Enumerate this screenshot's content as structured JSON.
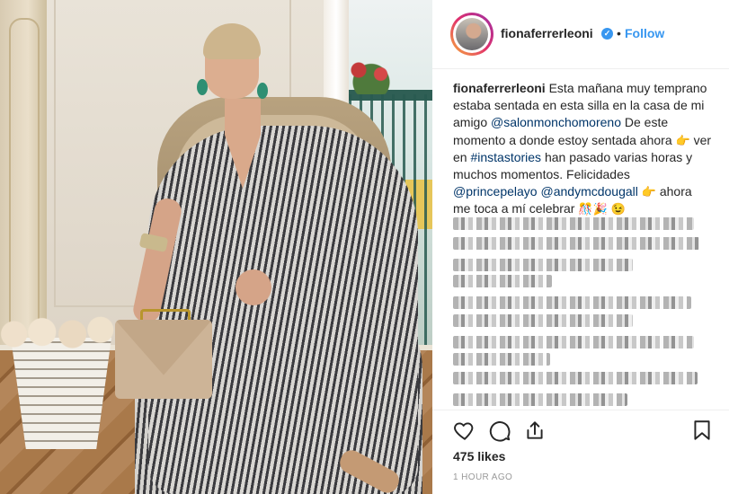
{
  "post": {
    "username": "fionaferrerleoni",
    "verified_mark": "✓",
    "separator": "•",
    "follow_label": "Follow",
    "caption": {
      "username": "fionaferrerleoni",
      "text_1": " Esta mañana muy temprano estaba sentada en esta silla en la casa de mi amigo ",
      "mention_1": "@salonmonchomoreno",
      "text_2": " De este momento a donde estoy sentada ahora ",
      "emoji_1": "👉",
      "text_3": " ver en ",
      "hashtag_1": "#instastories",
      "text_4": " han pasado varias horas y muchos momentos. Felicidades ",
      "mention_2": "@princepelayo",
      "text_5": " ",
      "mention_3": "@andymcdougall",
      "text_6": " ",
      "emoji_2": "👉",
      "text_7": " ahora me toca a mí celebrar ",
      "emoji_3": "🎊",
      "emoji_4": "🎉",
      "emoji_5": "😉"
    },
    "likes": "475 likes",
    "timestamp": "1 HOUR AGO"
  },
  "icons": {
    "like": "heart-icon",
    "comment": "comment-icon",
    "share": "share-icon",
    "save": "bookmark-icon"
  },
  "colors": {
    "link": "#003569",
    "follow": "#3897f0",
    "verified": "#3897f0",
    "muted": "#999999"
  }
}
